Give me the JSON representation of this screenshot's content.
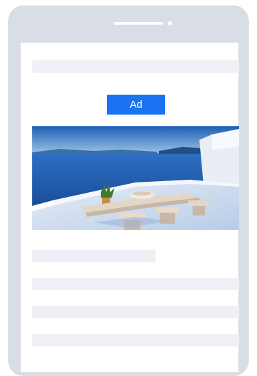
{
  "ad": {
    "label": "Ad",
    "badge_color": "#1a73f0",
    "image_icon": "seaside-terrace-photo"
  },
  "device": {
    "type": "smartphone-outline",
    "frame_color": "#d9dde6"
  },
  "placeholders": {
    "skeleton_color": "#eef0f5",
    "line_count": 5
  }
}
